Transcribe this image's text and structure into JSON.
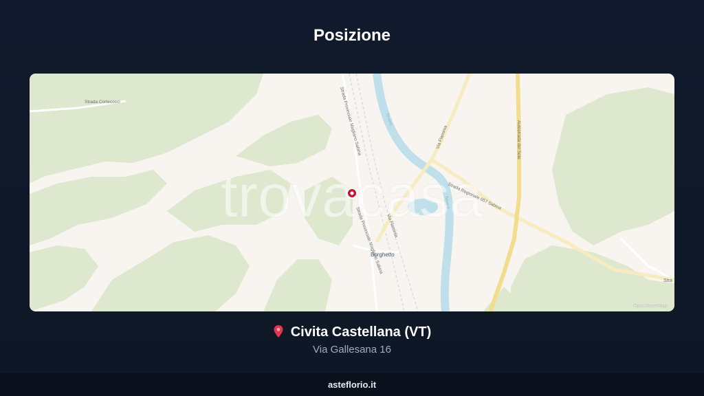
{
  "header": {
    "title": "Posizione"
  },
  "map": {
    "watermark": "trovacasa",
    "labels": {
      "strada_cortecocci": "Strada Cortecocci",
      "sp_magliano_1": "Strada Provinciale Magliano Sabina",
      "sp_magliano_2": "Strada Provinciale Magliano Sabina",
      "via_flaminia_1": "Via Flaminia",
      "via_flaminia_2": "Via Flaminia",
      "ss_sabina": "Strada Regionale 657 Sabina",
      "autostrada": "Autostrada del Sole",
      "tevere_1": "Tevere",
      "tevere_2": "Tevere",
      "borghetto": "Borghetto",
      "edge_label": "Stra",
      "attribution": "OpenStreetMap"
    },
    "colors": {
      "land": "#f8f4ef",
      "vegetation": "#dde8cf",
      "river": "#bfe0ea",
      "highway": "#f2dc8e",
      "marker": "#c8102e"
    }
  },
  "location": {
    "pin_icon": "red-pin",
    "city": "Civita Castellana (VT)",
    "address": "Via Gallesana 16"
  },
  "footer": {
    "brand": "asteflorio.it"
  }
}
